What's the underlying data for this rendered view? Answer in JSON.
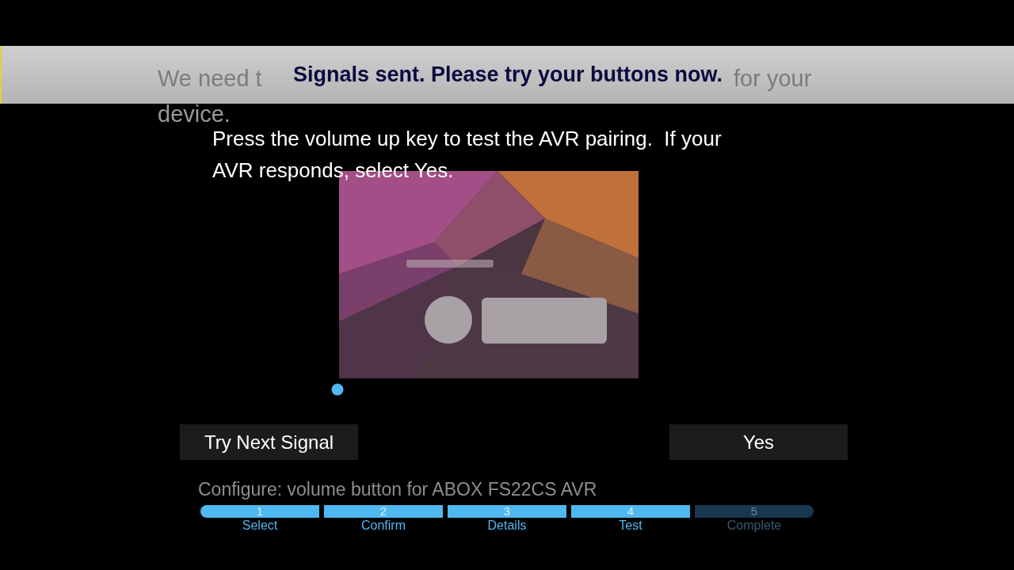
{
  "background_prompt": {
    "line_1_start": "We need t",
    "line_1_end": "for your",
    "line_2": "device."
  },
  "banner": {
    "message": "Signals sent. Please try your buttons now."
  },
  "instruction": "Press the volume up key to test the AVR pairing.  If your AVR responds, select Yes.",
  "buttons": [
    {
      "label": "Try Next Signal",
      "selected": false
    },
    {
      "label": "Yes",
      "selected": false
    }
  ],
  "configure_caption": "Configure: volume button for ABOX FS22CS AVR",
  "steps": [
    {
      "number": "1",
      "label": "Select",
      "done": true
    },
    {
      "number": "2",
      "label": "Confirm",
      "done": true
    },
    {
      "number": "3",
      "label": "Details",
      "done": true
    },
    {
      "number": "4",
      "label": "Test",
      "done": true
    },
    {
      "number": "5",
      "label": "Complete",
      "done": false
    }
  ]
}
